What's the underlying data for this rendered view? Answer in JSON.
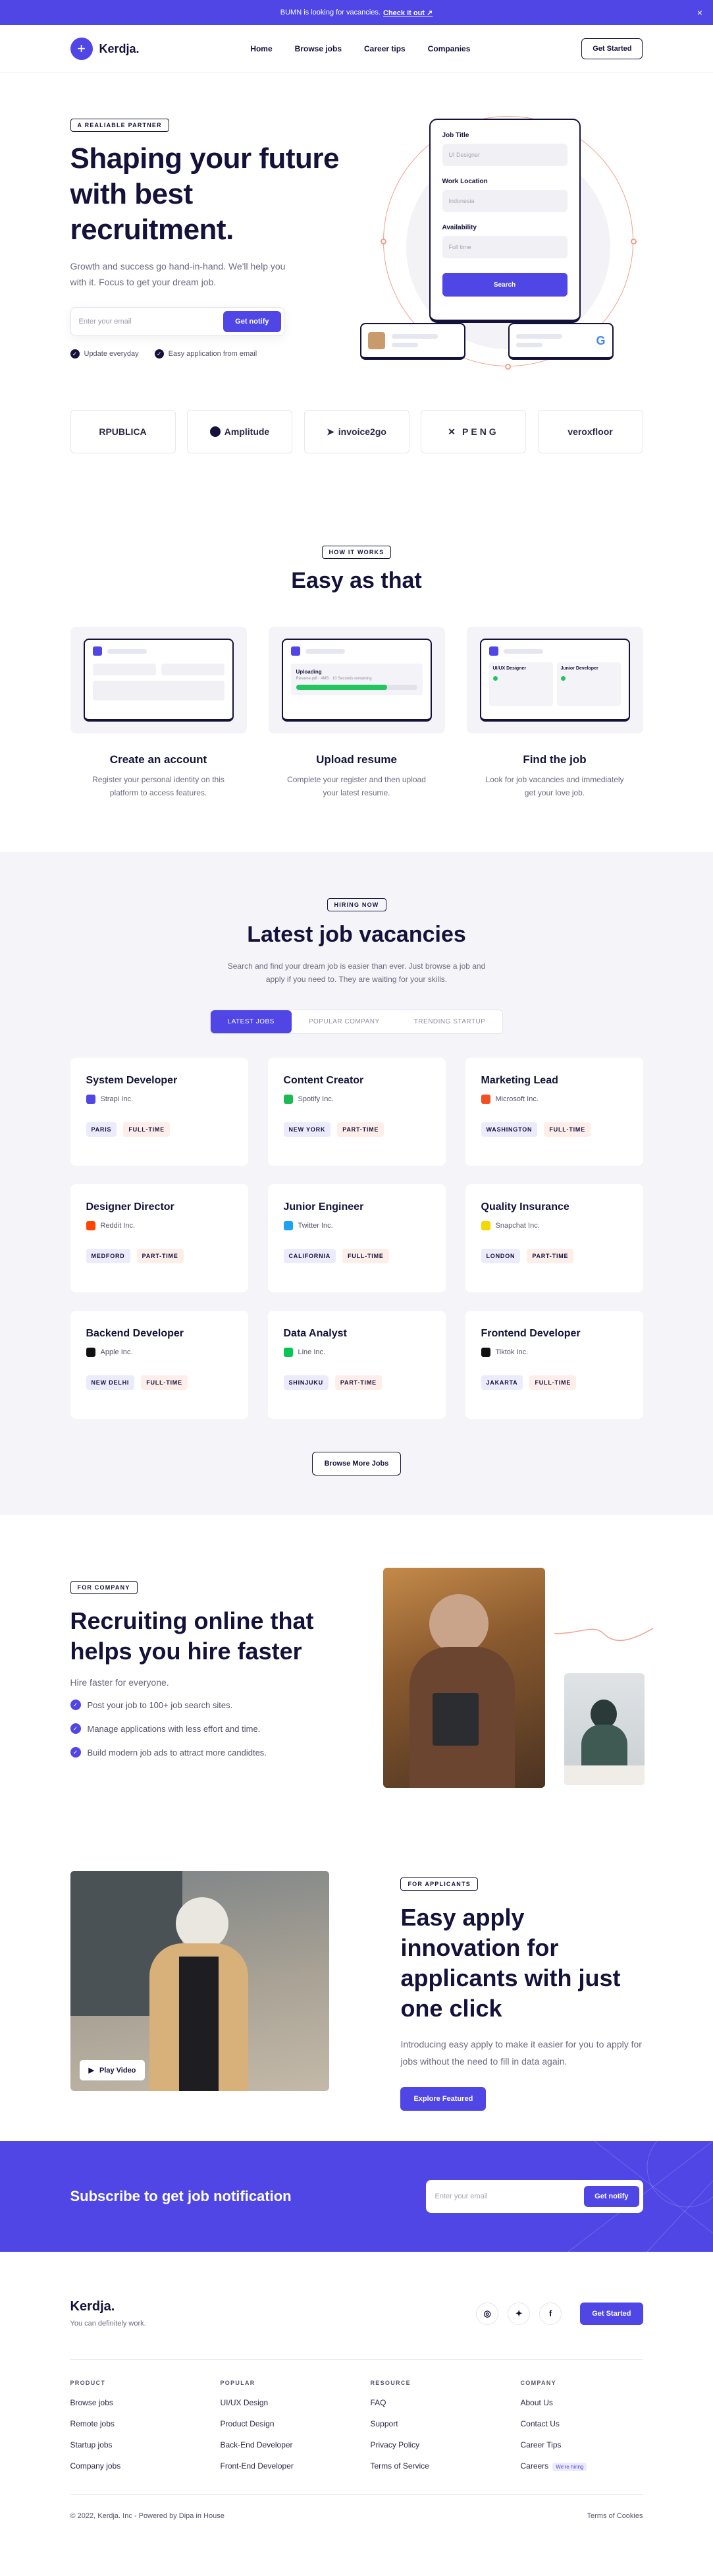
{
  "banner": {
    "text": "BUMN is looking for vacancies.",
    "link": "Check it out ↗",
    "close": "×"
  },
  "nav": {
    "logo": "Kerdja.",
    "items": [
      "Home",
      "Browse jobs",
      "Career tips",
      "Companies"
    ],
    "cta": "Get Started"
  },
  "hero": {
    "badge": "A REALIABLE PARTNER",
    "title": "Shaping your future with best recruitment.",
    "subtitle": "Growth and success go hand-in-hand. We'll help you with it. Focus to get your dream job.",
    "email_placeholder": "Enter your email",
    "notify_button": "Get notify",
    "checks": [
      "Update everyday",
      "Easy application from email"
    ],
    "form": {
      "job_title_label": "Job Title",
      "job_title_value": "UI Designer",
      "location_label": "Work Location",
      "location_value": "Indonesia",
      "availability_label": "Availability",
      "availability_value": "Full time",
      "button": "Search"
    }
  },
  "logos": [
    "RPUBLICA",
    "Amplitude",
    "invoice2go",
    "PENG",
    "veroxfloor"
  ],
  "how": {
    "badge": "HOW IT WORKS",
    "title": "Easy as that",
    "upload": {
      "title": "Uploading",
      "detail": "Resume.pdf · 4MB · 10 Seconds remaining"
    },
    "cards": [
      "UI/UX Designer",
      "Junior Developer"
    ],
    "steps": [
      {
        "title": "Create an account",
        "text": "Register your personal identity on this platform to access features."
      },
      {
        "title": "Upload resume",
        "text": "Complete your register and then upload your latest resume."
      },
      {
        "title": "Find the job",
        "text": "Look for job vacancies and immediately get your love job."
      }
    ]
  },
  "jobs": {
    "badge": "HIRING NOW",
    "title": "Latest job vacancies",
    "lead": "Search and find your dream job is easier than ever. Just browse a job and apply if you need to. They are waiting for your skills.",
    "tabs": [
      "LATEST JOBS",
      "POPULAR COMPANY",
      "TRENDING STARTUP"
    ],
    "list": [
      {
        "title": "System Developer",
        "company": "Strapi Inc.",
        "loc": "PARIS",
        "type": "FULL-TIME",
        "color": "#4f46e5"
      },
      {
        "title": "Content Creator",
        "company": "Spotify Inc.",
        "loc": "NEW YORK",
        "type": "PART-TIME",
        "color": "#1db954"
      },
      {
        "title": "Marketing Lead",
        "company": "Microsoft Inc.",
        "loc": "WASHINGTON",
        "type": "FULL-TIME",
        "color": "#f25022"
      },
      {
        "title": "Designer Director",
        "company": "Reddit Inc.",
        "loc": "MEDFORD",
        "type": "PART-TIME",
        "color": "#ff4500"
      },
      {
        "title": "Junior Engineer",
        "company": "Twitter Inc.",
        "loc": "CALIFORNIA",
        "type": "FULL-TIME",
        "color": "#1da1f2"
      },
      {
        "title": "Quality Insurance",
        "company": "Snapchat Inc.",
        "loc": "LONDON",
        "type": "PART-TIME",
        "color": "#f5d800"
      },
      {
        "title": "Backend Developer",
        "company": "Apple Inc.",
        "loc": "NEW DELHI",
        "type": "FULL-TIME",
        "color": "#111111"
      },
      {
        "title": "Data Analyst",
        "company": "Line Inc.",
        "loc": "SHINJUKU",
        "type": "PART-TIME",
        "color": "#06c755"
      },
      {
        "title": "Frontend Developer",
        "company": "Tiktok Inc.",
        "loc": "JAKARTA",
        "type": "FULL-TIME",
        "color": "#111111"
      }
    ],
    "more": "Browse More Jobs"
  },
  "company": {
    "badge": "FOR COMPANY",
    "title": "Recruiting online that helps you hire faster",
    "subtitle": "Hire faster for everyone.",
    "points": [
      "Post your job to 100+ job search sites.",
      "Manage applications with less effort and time.",
      "Build modern job ads to attract more candidtes."
    ]
  },
  "applicants": {
    "badge": "FOR APPLICANTS",
    "title": "Easy apply innovation for applicants with just one click",
    "text": "Introducing easy apply to make it easier for you to apply for jobs without the need to fill in data again.",
    "button": "Explore Featured",
    "play": "Play Video"
  },
  "subscribe": {
    "title": "Subscribe to get job notification",
    "placeholder": "Enter your email",
    "button": "Get notify"
  },
  "footer": {
    "brand": "Kerdja.",
    "tagline": "You can definitely work.",
    "cta": "Get Started",
    "cols": [
      {
        "head": "PRODUCT",
        "items": [
          "Browse jobs",
          "Remote jobs",
          "Startup jobs",
          "Company jobs"
        ]
      },
      {
        "head": "POPULAR",
        "items": [
          "UI/UX Design",
          "Product Design",
          "Back-End Developer",
          "Front-End Developer"
        ]
      },
      {
        "head": "RESOURCE",
        "items": [
          "FAQ",
          "Support",
          "Privacy Policy",
          "Terms of Service"
        ]
      },
      {
        "head": "COMPANY",
        "items": [
          "About Us",
          "Contact Us",
          "Career Tips",
          "Careers"
        ]
      }
    ],
    "hiring_badge": "We're hiring",
    "copyright": "© 2022, Kerdja. Inc - Powered by Dipa in House",
    "terms": "Terms of Cookies"
  },
  "colors": {
    "accent": "#4f46e5",
    "navy": "#14123a",
    "coral": "#f1a08b"
  }
}
